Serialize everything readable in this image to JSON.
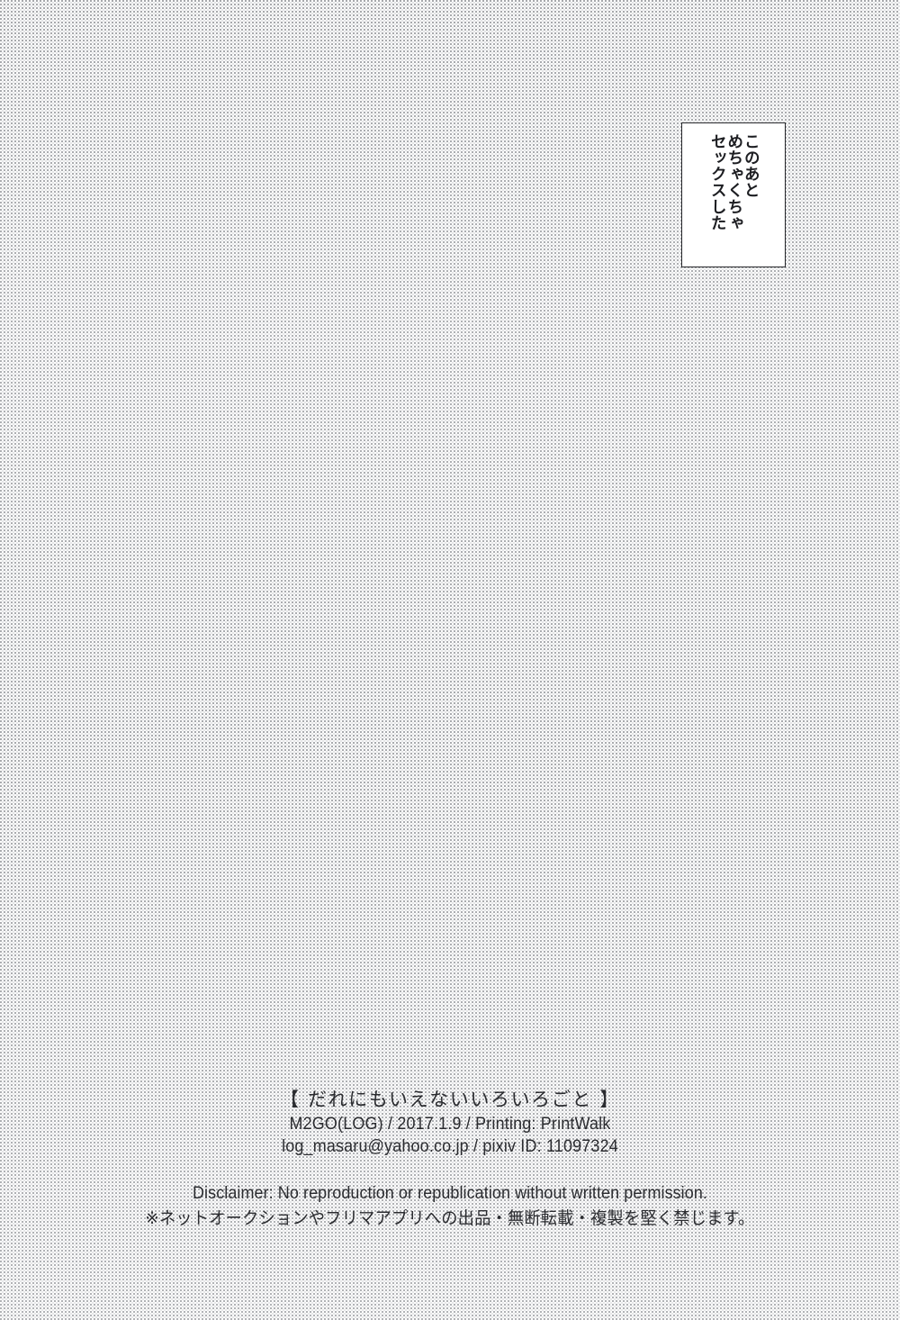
{
  "page": {
    "background_tone": "halftone-dot-screentone",
    "background_color": "#fdfdfd",
    "ink_color": "#2b2c30"
  },
  "note_box": {
    "border_color": "#26272b",
    "fill_color": "#ffffff",
    "direction": "vertical-rtl",
    "columns": [
      "このあと",
      "めちゃくちゃ",
      "セックスした"
    ]
  },
  "colophon": {
    "title": "【 だれにもいえないいろいろごと 】",
    "credits": [
      "M2GO(LOG) / 2017.1.9 / Printing: PrintWalk",
      "log_masaru@yahoo.co.jp / pixiv ID: 11097324"
    ],
    "disclaimer_en": "Disclaimer: No reproduction or republication without written permission.",
    "disclaimer_ja": "※ネットオークションやフリマアプリへの出品・無断転載・複製を堅く禁じます。"
  }
}
